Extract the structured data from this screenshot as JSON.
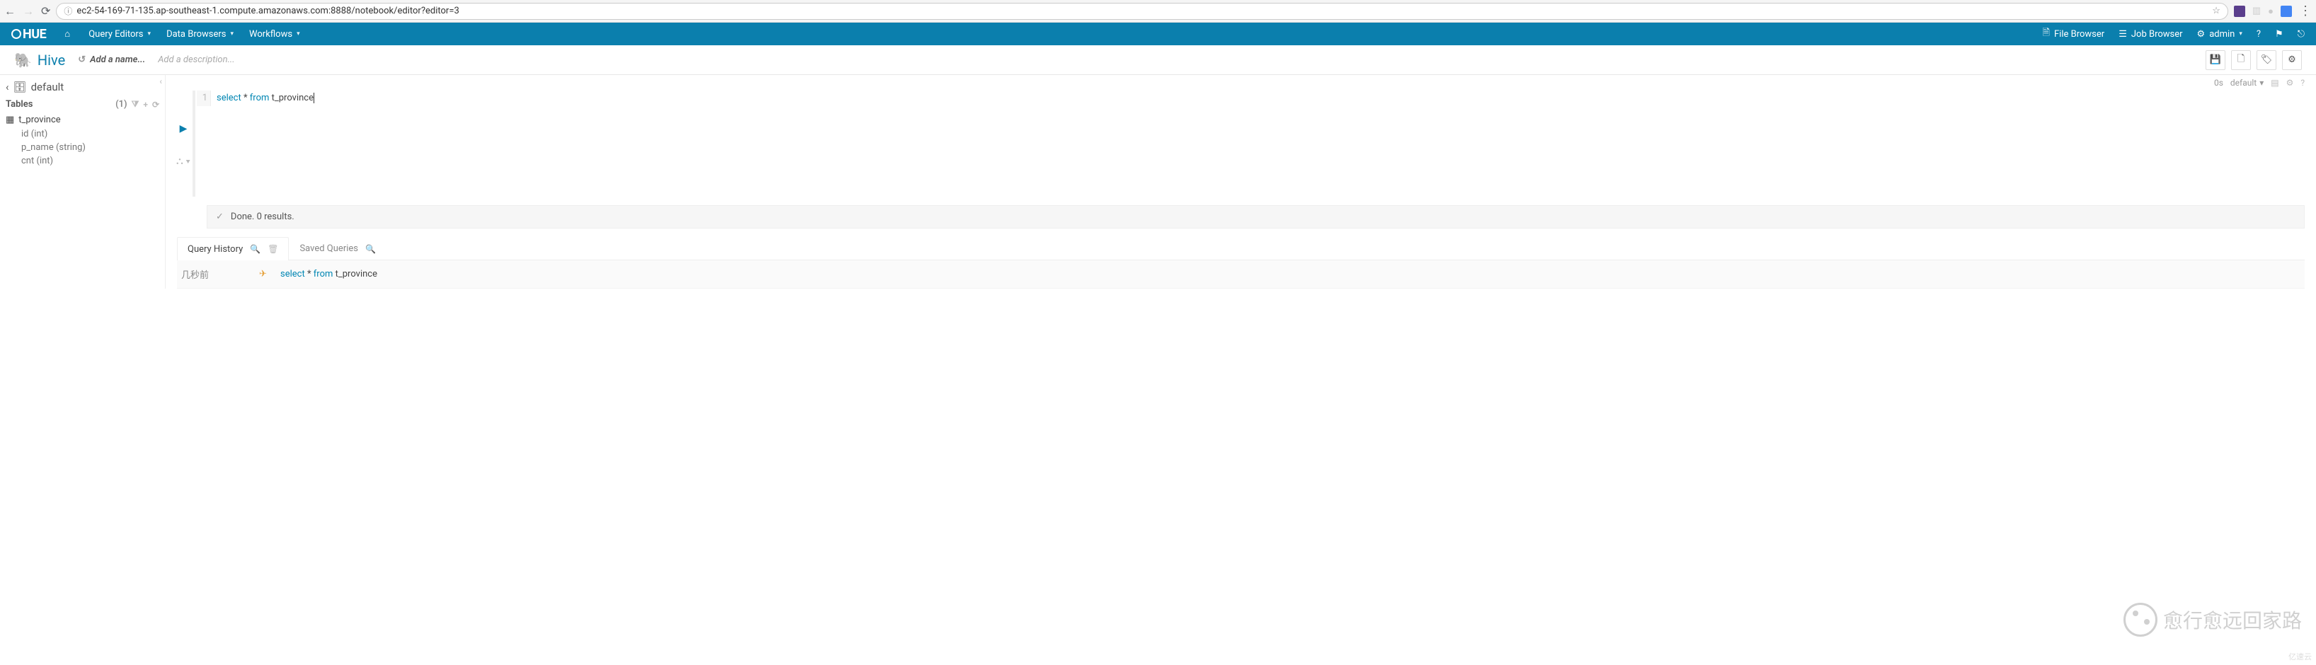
{
  "browser": {
    "url_display": "ec2-54-169-71-135.ap-southeast-1.compute.amazonaws.com:8888/notebook/editor?editor=3"
  },
  "hue_nav": {
    "home_icon": "home",
    "menus": [
      "Query Editors",
      "Data Browsers",
      "Workflows"
    ],
    "right": {
      "file_browser": "File Browser",
      "job_browser": "Job Browser",
      "admin": "admin"
    }
  },
  "sub_header": {
    "app": "Hive",
    "add_name": "Add a name...",
    "add_desc": "Add a description..."
  },
  "sidebar": {
    "database": "default",
    "tables_label": "Tables",
    "count": "(1)",
    "tables": [
      {
        "name": "t_province",
        "columns": [
          {
            "name": "id",
            "type": "int"
          },
          {
            "name": "p_name",
            "type": "string"
          },
          {
            "name": "cnt",
            "type": "int"
          }
        ]
      }
    ]
  },
  "editor": {
    "elapsed": "0s",
    "db": "default",
    "line_no": "1",
    "sql_kw1": "select",
    "sql_rest": " * ",
    "sql_kw2": "from",
    "sql_tbl": " t_province"
  },
  "status": {
    "text": "Done. 0 results."
  },
  "tabs": {
    "history": "Query History",
    "saved": "Saved Queries"
  },
  "history": {
    "ago": "几秒前",
    "sql_kw1": "select",
    "sql_rest": " * ",
    "sql_kw2": "from",
    "sql_tbl": " t_province"
  },
  "watermark": "愈行愈远回家路",
  "footer": "亿速云"
}
